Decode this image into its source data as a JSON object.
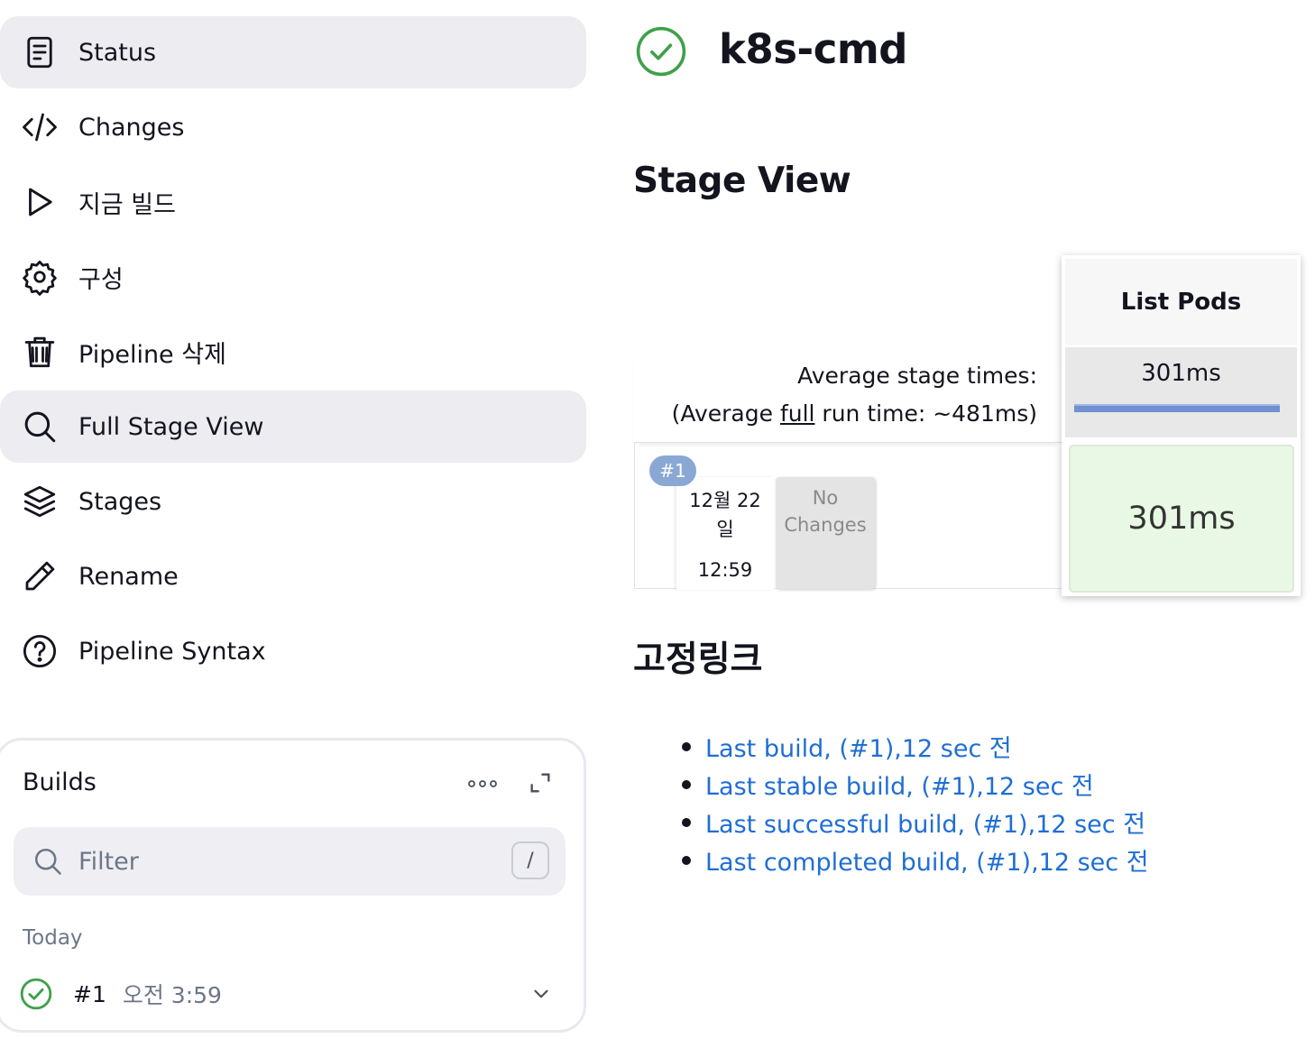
{
  "sidebar": {
    "items": [
      {
        "label": "Status",
        "icon": "document-icon",
        "active": true
      },
      {
        "label": "Changes",
        "icon": "code-icon",
        "active": false
      },
      {
        "label": "지금 빌드",
        "icon": "play-icon",
        "active": false
      },
      {
        "label": "구성",
        "icon": "gear-icon",
        "active": false
      },
      {
        "label": "Pipeline 삭제",
        "icon": "trash-icon",
        "active": false
      },
      {
        "label": "Full Stage View",
        "icon": "search-icon",
        "active": true
      },
      {
        "label": "Stages",
        "icon": "layers-icon",
        "active": false
      },
      {
        "label": "Rename",
        "icon": "pencil-icon",
        "active": false
      },
      {
        "label": "Pipeline Syntax",
        "icon": "help-icon",
        "active": false
      }
    ]
  },
  "builds_panel": {
    "title": "Builds",
    "filter_placeholder": "Filter",
    "filter_shortcut": "/",
    "group_label": "Today",
    "builds": [
      {
        "number": "#1",
        "time": "오전 3:59",
        "status": "success"
      }
    ]
  },
  "job": {
    "title": "k8s-cmd",
    "status": "success"
  },
  "stage_view": {
    "heading": "Stage View",
    "avg_stage_times_label": "Average stage times:",
    "avg_full_prefix": "(Average ",
    "avg_full_link": "full",
    "avg_full_suffix": " run time: ~481ms)",
    "stages": [
      {
        "name": "List Pods",
        "avg_time": "301ms"
      }
    ],
    "runs": [
      {
        "badge": "#1",
        "date_line1": "12월 22",
        "date_line2": "일",
        "time": "12:59",
        "changes_line1": "No",
        "changes_line2": "Changes",
        "stage_times": [
          "301ms"
        ]
      }
    ]
  },
  "permalinks": {
    "heading": "고정링크",
    "links": [
      "Last build, (#1),12 sec 전",
      "Last stable build, (#1),12 sec 전",
      "Last successful build, (#1),12 sec 전",
      "Last completed build, (#1),12 sec 전"
    ]
  },
  "colors": {
    "success": "#3fa04a",
    "link": "#1f6ed4",
    "active_nav_bg": "#ececf1",
    "stage_success_bg": "#e9f8e4",
    "avg_bar": "#7090cf",
    "badge_bg": "#8aa8d4"
  }
}
